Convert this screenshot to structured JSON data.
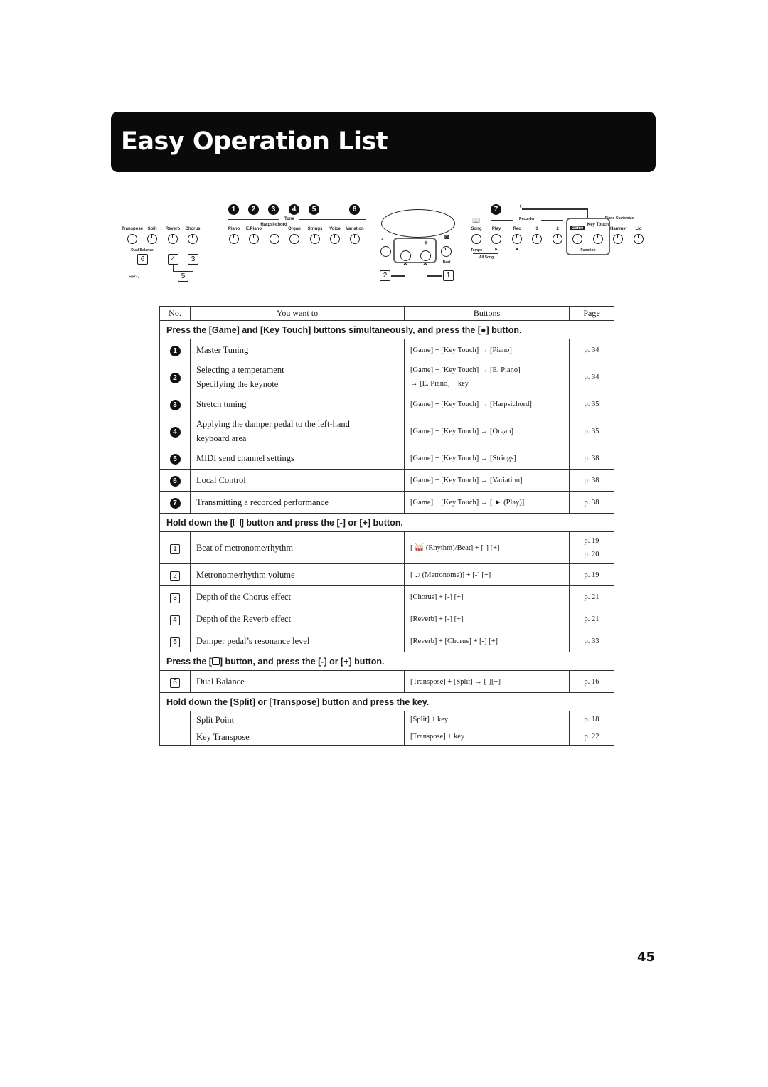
{
  "page": {
    "title": "Easy Operation List",
    "page_number": "45"
  },
  "panel": {
    "model": "HP-7",
    "left_buttons": [
      "Transpose",
      "Split",
      "Reverb",
      "Chorus"
    ],
    "dual_balance_label": "Dual Balance",
    "tone_label": "Tone",
    "tone_buttons": [
      "Piano",
      "E.Piano",
      "Harpsi-chord",
      "Organ",
      "Strings",
      "Voice",
      "Variation"
    ],
    "tone_numbers": [
      "1",
      "2",
      "3",
      "4",
      "5",
      "6"
    ],
    "box_numbers": [
      "6",
      "4",
      "3",
      "5",
      "2",
      "1"
    ],
    "minus": "–",
    "plus": "+",
    "beat_label": "Beat",
    "recorder_label": "Recorder",
    "piano_customize_label": "Piano Customize",
    "right_buttons": [
      "Song",
      "Play",
      "Rec",
      "1",
      "2",
      "Game",
      "Key Touch",
      "Hammer",
      "Lid"
    ],
    "tempo_label": "Tempo",
    "play_symbol": "►",
    "rec_symbol": "●",
    "all_song_label": "All Song",
    "function_label": "Function",
    "number_7": "7"
  },
  "table": {
    "headers": {
      "no": "No.",
      "want": "You want to",
      "buttons": "Buttons",
      "page": "Page"
    },
    "sections": [
      {
        "heading": "Press the [Game] and [Key Touch] buttons simultaneously, and press the [●] button.",
        "rows": [
          {
            "no": "1",
            "want": [
              "Master Tuning"
            ],
            "buttons": [
              "[Game] + [Key Touch] → [Piano]"
            ],
            "page": [
              "p. 34"
            ]
          },
          {
            "no": "2",
            "want": [
              "Selecting a temperament",
              "Specifying the keynote"
            ],
            "buttons": [
              "[Game] + [Key Touch] → [E. Piano]",
              "→ [E. Piano] + key"
            ],
            "page": [
              "p. 34"
            ]
          },
          {
            "no": "3",
            "want": [
              "Stretch tuning"
            ],
            "buttons": [
              "[Game] + [Key Touch] → [Harpsichord]"
            ],
            "page": [
              "p. 35"
            ]
          },
          {
            "no": "4",
            "want": [
              "Applying the damper pedal to the left-hand",
              "keyboard area"
            ],
            "buttons": [
              "[Game] + [Key Touch] → [Organ]"
            ],
            "page": [
              "p. 35"
            ]
          },
          {
            "no": "5",
            "want": [
              "MIDI send channel settings"
            ],
            "buttons": [
              "[Game] + [Key Touch] → [Strings]"
            ],
            "page": [
              "p. 38"
            ]
          },
          {
            "no": "6",
            "want": [
              "Local Control"
            ],
            "buttons": [
              "[Game] + [Key Touch] → [Variation]"
            ],
            "page": [
              "p. 38"
            ]
          },
          {
            "no": "7",
            "want": [
              "Transmitting a recorded performance"
            ],
            "buttons": [
              "[Game] + [Key Touch] → [ ► (Play)]"
            ],
            "page": [
              "p. 38"
            ]
          }
        ]
      },
      {
        "heading_pre": "Hold down the [",
        "heading_post": "] button and press the [-] or [+] button.",
        "rows": [
          {
            "no": "1",
            "want": [
              "Beat of metronome/rhythm"
            ],
            "buttons": [
              "[ 🥁 (Rhythm)/Beat] + [-] [+]"
            ],
            "page": [
              "p. 19",
              "p. 20"
            ]
          },
          {
            "no": "2",
            "want": [
              "Metronome/rhythm volume"
            ],
            "buttons": [
              "[ ♫ (Metronome)] + [-] [+]"
            ],
            "page": [
              "p. 19"
            ]
          },
          {
            "no": "3",
            "want": [
              "Depth of the Chorus effect"
            ],
            "buttons": [
              "[Chorus] + [-] [+]"
            ],
            "page": [
              "p. 21"
            ]
          },
          {
            "no": "4",
            "want": [
              "Depth of the Reverb effect"
            ],
            "buttons": [
              "[Reverb] + [-] [+]"
            ],
            "page": [
              "p. 21"
            ]
          },
          {
            "no": "5",
            "want": [
              "Damper pedal’s resonance level"
            ],
            "buttons": [
              "[Reverb] + [Chorus] + [-] [+]"
            ],
            "page": [
              "p. 33"
            ]
          }
        ]
      },
      {
        "heading_pre": "Press the [",
        "heading_post": "] button, and press the [-] or [+] button.",
        "rows": [
          {
            "no": "6",
            "want": [
              "Dual Balance"
            ],
            "buttons": [
              "[Transpose] + [Split] → [-][+]"
            ],
            "page": [
              "p. 16"
            ]
          }
        ]
      },
      {
        "heading": "Hold down the [Split] or [Transpose] button and press the key.",
        "rows": [
          {
            "no": "",
            "want": [
              "Split Point"
            ],
            "buttons": [
              "[Split] + key"
            ],
            "page": [
              "p. 18"
            ]
          },
          {
            "no": "",
            "want": [
              "Key Transpose"
            ],
            "buttons": [
              "[Transpose] + key"
            ],
            "page": [
              "p. 22"
            ]
          }
        ]
      }
    ]
  }
}
